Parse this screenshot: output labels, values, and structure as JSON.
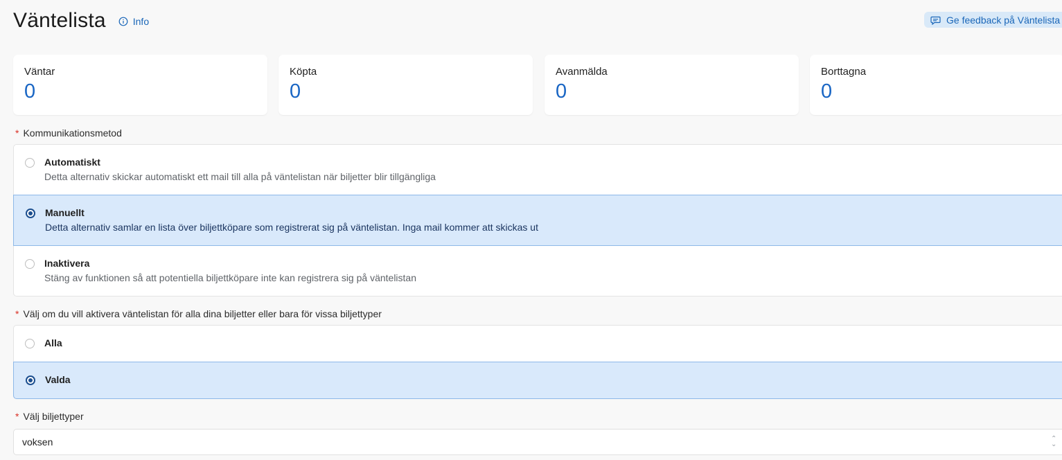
{
  "header": {
    "title": "Väntelista",
    "info_label": "Info",
    "feedback_label": "Ge feedback på Väntelista"
  },
  "stats": [
    {
      "label": "Väntar",
      "value": "0"
    },
    {
      "label": "Köpta",
      "value": "0"
    },
    {
      "label": "Avanmälda",
      "value": "0"
    },
    {
      "label": "Borttagna",
      "value": "0"
    }
  ],
  "communication": {
    "required_mark": "*",
    "label": "Kommunikationsmetod",
    "options": [
      {
        "title": "Automatiskt",
        "description": "Detta alternativ skickar automatiskt ett mail till alla på väntelistan när biljetter blir tillgängliga",
        "selected": false
      },
      {
        "title": "Manuellt",
        "description": "Detta alternativ samlar en lista över biljettköpare som registrerat sig på väntelistan. Inga mail kommer att skickas ut",
        "selected": true
      },
      {
        "title": "Inaktivera",
        "description": "Stäng av funktionen så att potentiella biljettköpare inte kan registrera sig på väntelistan",
        "selected": false
      }
    ]
  },
  "scope": {
    "required_mark": "*",
    "label": "Välj om du vill aktivera väntelistan för alla dina biljetter eller bara för vissa biljettyper",
    "options": [
      {
        "title": "Alla",
        "selected": false
      },
      {
        "title": "Valda",
        "selected": true
      }
    ]
  },
  "ticket_types": {
    "required_mark": "*",
    "label": "Välj biljettyper",
    "value": "voksen"
  },
  "colors": {
    "accent": "#1a66c4",
    "selected_bg": "#d9e9fb",
    "required": "#d93025"
  }
}
